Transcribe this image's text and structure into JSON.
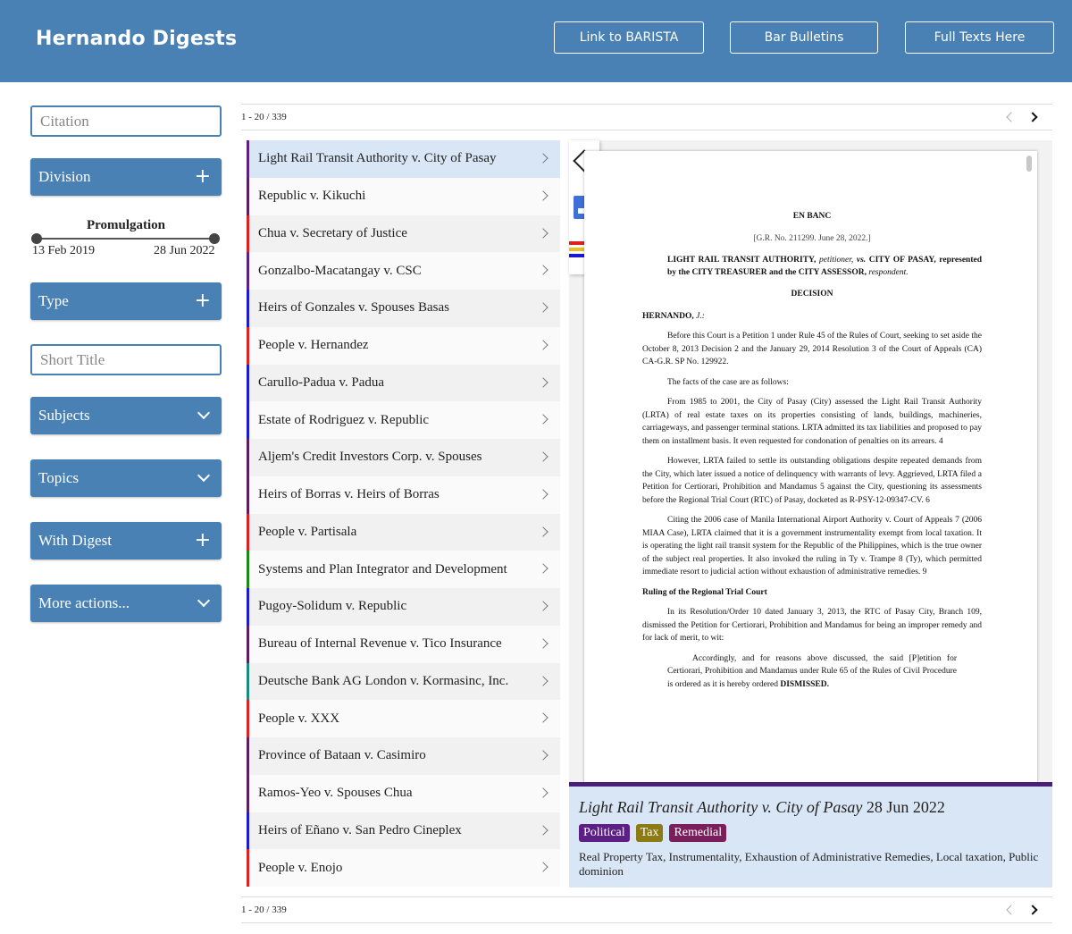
{
  "header": {
    "brand": "Hernando Digests",
    "buttons": [
      "Link to BARISTA",
      "Bar Bulletins",
      "Full Texts Here"
    ]
  },
  "sidebar": {
    "citation_placeholder": "Citation",
    "division_label": "Division",
    "promulgation_label": "Promulgation",
    "date_from": "13 Feb 2019",
    "date_to": "28 Jun 2022",
    "type_label": "Type",
    "short_title_placeholder": "Short Title",
    "subjects_label": "Subjects",
    "topics_label": "Topics",
    "with_digest_label": "With Digest",
    "more_actions_label": "More actions..."
  },
  "pager": {
    "range": "1 - 20",
    "total": "339"
  },
  "colors": {
    "accent": "#4a81b5",
    "political": "#5b1f86",
    "tax": "#8c7a14",
    "remedial": "#7a1f5c"
  },
  "cases": [
    {
      "title": "Light Rail Transit Authority v. City of Pasay",
      "color": "#5b1f86"
    },
    {
      "title": "Republic v. Kikuchi",
      "color": "#5b1f5f"
    },
    {
      "title": "Chua v. Secretary of Justice",
      "color": "#e02020"
    },
    {
      "title": "Gonzalbo-Macatangay v. CSC",
      "color": "#5b1f86"
    },
    {
      "title": "Heirs of Gonzales v. Spouses Basas",
      "color": "#1a1ad6"
    },
    {
      "title": "People v. Hernandez",
      "color": "#e02020"
    },
    {
      "title": "Carullo-Padua v. Padua",
      "color": "#1a1ad6"
    },
    {
      "title": "Estate of Rodriguez v. Republic",
      "color": "#1a1ad6"
    },
    {
      "title": "Aljem's Credit Investors Corp. v. Spouses",
      "color": "#5b1f5f"
    },
    {
      "title": "Heirs of Borras v. Heirs of Borras",
      "color": "#5b1f5f"
    },
    {
      "title": "People v. Partisala",
      "color": "#e02020"
    },
    {
      "title": "Systems and Plan Integrator and Development",
      "color": "#1a8a1a"
    },
    {
      "title": "Pugoy-Solidum v. Republic",
      "color": "#1a1ad6"
    },
    {
      "title": "Bureau of Internal Revenue v. Tico Insurance",
      "color": "#5b1f5f"
    },
    {
      "title": "Deutsche Bank AG London v. Kormasinc, Inc.",
      "color": "#1a8a7a"
    },
    {
      "title": "People v. XXX",
      "color": "#e02020"
    },
    {
      "title": "Province of Bataan v. Casimiro",
      "color": "#5b1f5f"
    },
    {
      "title": "Ramos-Yeo v. Spouses Chua",
      "color": "#5b1f5f"
    },
    {
      "title": "Heirs of Eñano v. San Pedro Cineplex",
      "color": "#1a1ad6"
    },
    {
      "title": "People v. Enojo",
      "color": "#e02020"
    }
  ],
  "document": {
    "division": "EN BANC",
    "gr": "[G.R. No. 211299. June 28, 2022.]",
    "parties_1": "LIGHT RAIL TRANSIT AUTHORITY,",
    "petitioner": " petitioner,",
    "vs": " vs.",
    "parties_2": " CITY OF PASAY, represented by the CITY TREASURER and the CITY ASSESSOR,",
    "respondent": " respondent.",
    "heading": "DECISION",
    "ponente": "HERNANDO,",
    "ponente_j": " J.:",
    "p1": "Before this Court is a Petition 1 under Rule 45 of the Rules of Court, seeking to set aside the October 8, 2013 Decision 2 and the January 29, 2014 Resolution 3 of the Court of Appeals (CA) CA-G.R. SP No. 129922.",
    "p2": "The facts of the case are as follows:",
    "p3": "From 1985 to 2001, the City of Pasay (City) assessed the Light Rail Transit Authority (LRTA) of real estate taxes on its properties consisting of lands, buildings, machineries, carriageways, and passenger terminal stations. LRTA admitted its tax liabilities and proposed to pay them on installment basis. It even requested for condonation of penalties on its arrears. 4",
    "p4": "However, LRTA failed to settle its outstanding obligations despite repeated demands from the City, which later issued a notice of delinquency with warrants of levy. Aggrieved, LRTA filed a Petition for Certiorari, Prohibition and Mandamus 5 against the City, questioning its assessments before the Regional Trial Court (RTC) of Pasay, docketed as R-PSY-12-09347-CV. 6",
    "p5": "Citing the 2006 case of Manila International Airport Authority v. Court of Appeals 7 (2006 MIAA Case), LRTA claimed that it is a government instrumentality exempt from local taxation. It is operating the light rail transit system for the Republic of the Philippines, which is the true owner of the subject real properties. It also invoked the ruling in Ty v. Trampe 8 (Ty), which permitted immediate resort to judicial action without exhaustion of administrative remedies. 9",
    "sub": "Ruling of the Regional Trial Court",
    "p6": "In its Resolution/Order 10 dated January 3, 2013, the RTC of Pasay City, Branch 109, dismissed the Petition for Certiorari, Prohibition and Mandamus for being an improper remedy and for lack of merit, to wit:",
    "q1": "Accordingly, and for reasons above discussed, the said [P]etition for Certiorari, Prohibition and Mandamus under Rule 65 of the Rules of Civil Procedure is ordered as it is hereby ordered",
    "q1b": " DISMISSED."
  },
  "summary": {
    "title": "Light Rail Transit Authority v. City of Pasay",
    "date": " 28 Jun 2022",
    "tags": [
      "Political",
      "Tax",
      "Remedial"
    ],
    "keywords": "Real Property Tax, Instrumentality, Exhaustion of Administrative Remedies, Local taxation, Public dominion"
  }
}
